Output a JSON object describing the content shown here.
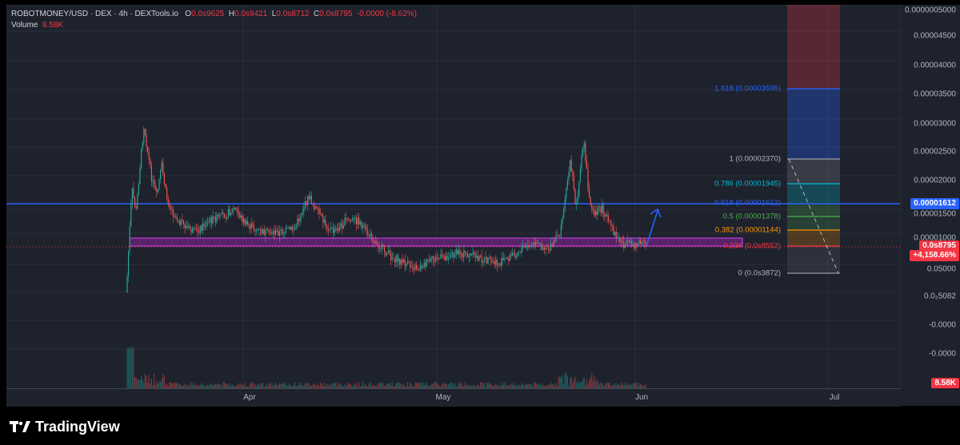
{
  "legend": {
    "symbol": "ROBOTMONEY/USD · DEX · 4h · DEXTools.io",
    "o_label": "O",
    "o_val": "0.0s9625",
    "h_label": "H",
    "h_val": "0.0s9421",
    "l_label": "L",
    "l_val": "0.0s8712",
    "c_label": "C",
    "c_val": "0.0s8795",
    "change": "-0.0000 (-8.62%)",
    "volume_label": "Volume",
    "volume_val": "8.58K"
  },
  "y_axis": {
    "ticks": [
      "0.0000005000",
      "0.00004500",
      "0.00004000",
      "0.00003500",
      "0.00003000",
      "0.00002500",
      "0.00002000",
      "0.00001500",
      "0.00001000",
      "0.05000",
      "0.0₂5082",
      "-0.0000",
      "-0.0000"
    ]
  },
  "x_axis": {
    "ticks": [
      "Apr",
      "May",
      "Jun",
      "Jul"
    ]
  },
  "price_tags": {
    "hline": "0.00001612",
    "last_price": "0.0s8795",
    "last_change": "+4,158.66%",
    "volume": "8.58K"
  },
  "fib": [
    {
      "label": "1.618 (0.00003595)",
      "color": "#2962ff"
    },
    {
      "label": "1 (0.00002370)",
      "color": "#b2b5be"
    },
    {
      "label": "0.786 (0.00001945)",
      "color": "#00bcd4"
    },
    {
      "label": "0.618 (0.00001612)",
      "color": "#2962ff"
    },
    {
      "label": "0.5 (0.00001378)",
      "color": "#4caf50"
    },
    {
      "label": "0.382 (0.00001144)",
      "color": "#ff9800"
    },
    {
      "label": "0.236 (0.0s8552)",
      "color": "#f23645"
    },
    {
      "label": "0 (0.0s3872)",
      "color": "#b2b5be"
    }
  ],
  "colors": {
    "up": "#26a69a",
    "down": "#ef5350",
    "hline": "#2962ff",
    "zone": "#9c27b0"
  },
  "brand": {
    "name": "TradingView"
  }
}
